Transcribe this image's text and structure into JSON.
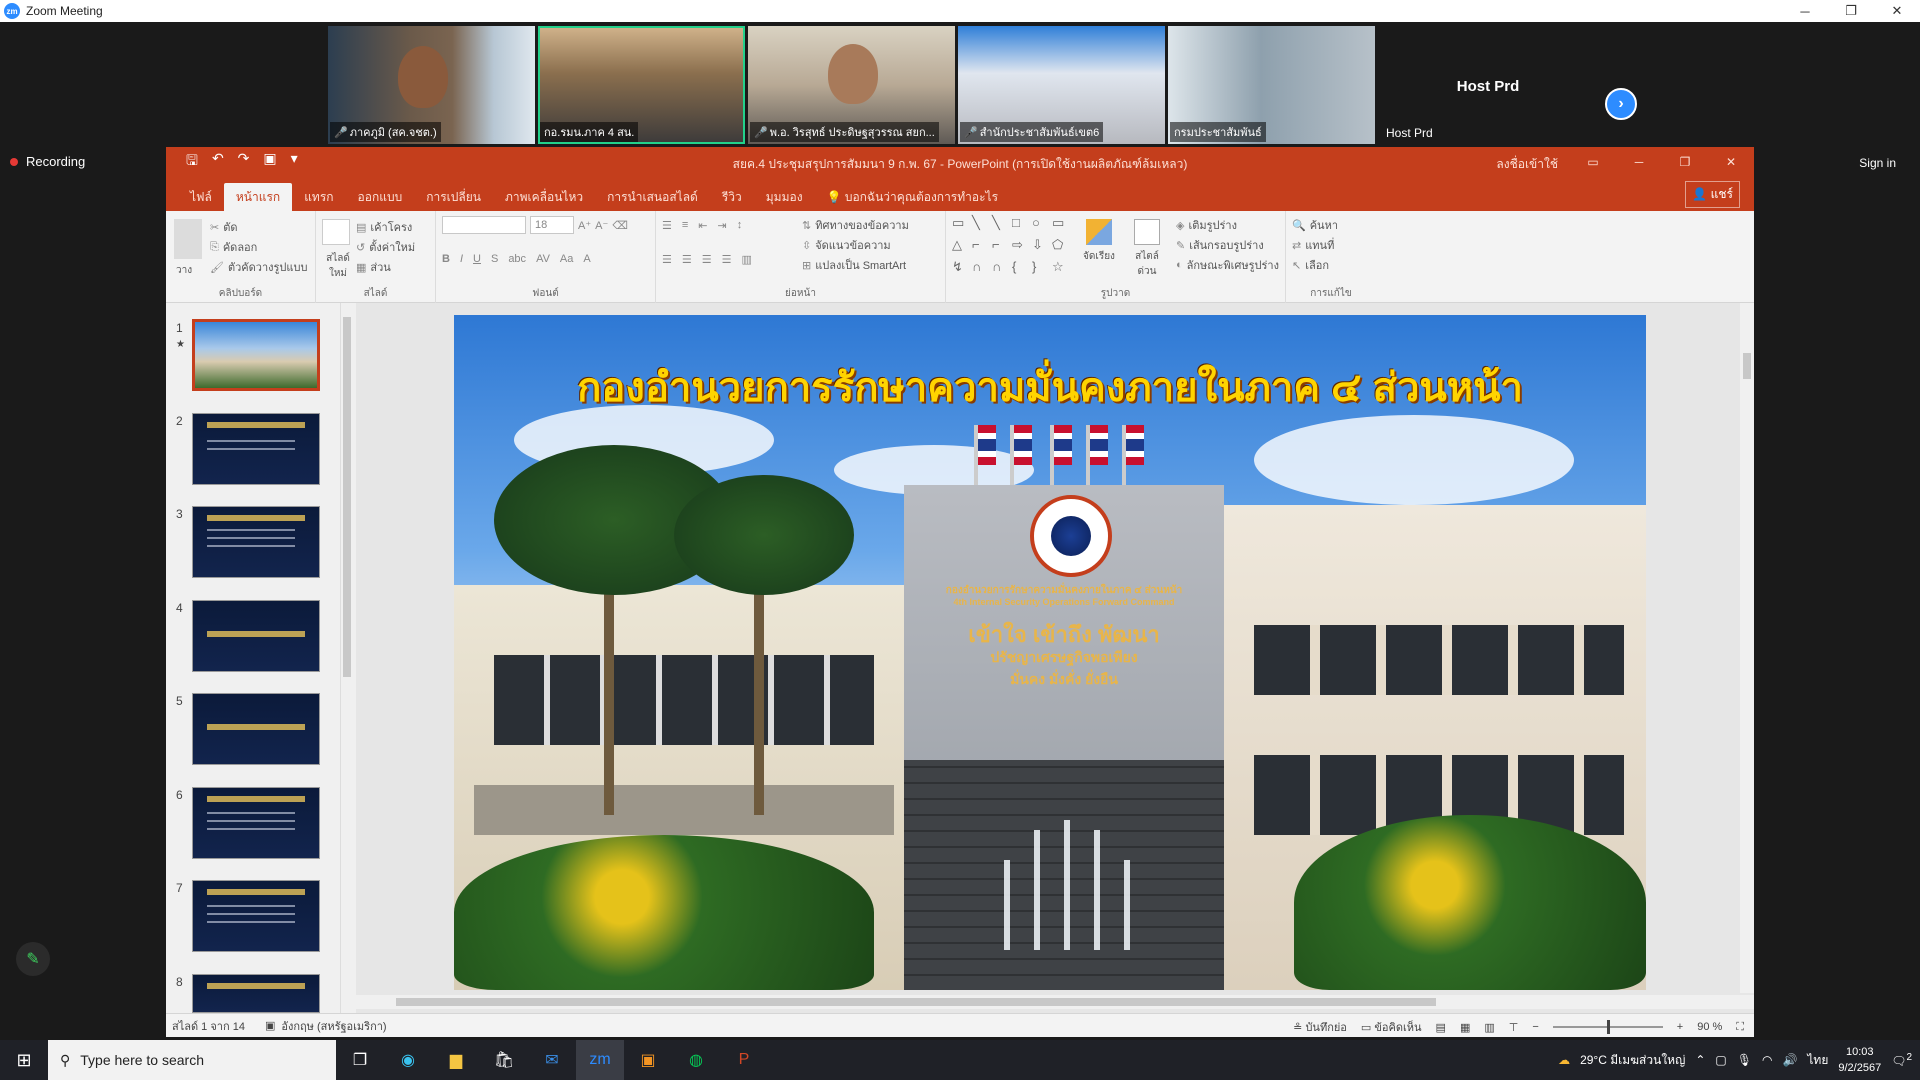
{
  "zoom": {
    "title": "Zoom Meeting",
    "logo_text": "zm",
    "recording_label": "Recording",
    "sign_in": "Sign in",
    "host_name_big": "Host Prd",
    "host_name_small": "Host Prd",
    "participants": [
      {
        "name": "ภาคภูมิ (สค.จชต.)",
        "muted": true
      },
      {
        "name": "กอ.รมน.ภาค 4 สน.",
        "muted": false
      },
      {
        "name": "พ.อ. วิรสุทธ์ ประดิษฐสุวรรณ สยก...",
        "muted": true
      },
      {
        "name": "สำนักประชาสัมพันธ์เขต6",
        "muted": true
      },
      {
        "name": "กรมประชาสัมพันธ์",
        "muted": false
      }
    ]
  },
  "powerpoint": {
    "doc_title": "สยค.4 ประชุมสรุปการสัมมนา 9 ก.พ. 67 - PowerPoint (การเปิดใช้งานผลิตภัณฑ์ล้มเหลว)",
    "sign_in": "ลงชื่อเข้าใช้",
    "share": "แชร์",
    "tabs": [
      "ไฟล์",
      "หน้าแรก",
      "แทรก",
      "ออกแบบ",
      "การเปลี่ยน",
      "ภาพเคลื่อนไหว",
      "การนำเสนอสไลด์",
      "รีวิว",
      "มุมมอง",
      "บอกฉันว่าคุณต้องการทำอะไร"
    ],
    "active_tab": "หน้าแรก",
    "ribbon": {
      "clipboard": {
        "paste": "วาง",
        "cut": "ตัด",
        "copy": "คัดลอก",
        "format_painter": "ตัวคัดวางรูปแบบ",
        "label": "คลิปบอร์ด"
      },
      "slides": {
        "new_slide": "สไลด์ใหม่",
        "layout": "เค้าโครง",
        "reset": "ตั้งค่าใหม่",
        "section": "ส่วน",
        "label": "สไลด์"
      },
      "font": {
        "size": "18",
        "label": "ฟอนต์"
      },
      "paragraph": {
        "text_direction": "ทิศทางของข้อความ",
        "align_text": "จัดแนวข้อความ",
        "smartart": "แปลงเป็น SmartArt",
        "label": "ย่อหน้า"
      },
      "drawing": {
        "arrange": "จัดเรียง",
        "quick_styles": "สไตล์ด่วน",
        "shape_fill": "เติมรูปร่าง",
        "shape_outline": "เส้นกรอบรูปร่าง",
        "shape_effects": "ลักษณะพิเศษรูปร่าง",
        "label": "รูปวาด"
      },
      "editing": {
        "find": "ค้นหา",
        "replace": "แทนที่",
        "select": "เลือก",
        "label": "การแก้ไข"
      }
    },
    "slide": {
      "title": "กองอำนวยการรักษาความมั่นคงภายในภาค ๔ ส่วนหน้า",
      "sign_line1": "กองอำนวยการรักษาความมั่นคงภายในภาค ๔ ส่วนหน้า",
      "sign_line2": "4th Internal Security Operations Forward Command",
      "sign_line3": "เข้าใจ เข้าถึง พัฒนา",
      "sign_line4": "ปรัชญาเศรษฐกิจพอเพียง",
      "sign_line5": "มั่นคง มั่งคั่ง ยั่งยืน"
    },
    "thumbnails": [
      "1",
      "2",
      "3",
      "4",
      "5",
      "6",
      "7",
      "8"
    ],
    "status": {
      "slide_count": "สไลด์ 1 จาก 14",
      "language": "อังกฤษ (สหรัฐอเมริกา)",
      "notes": "บันทึกย่อ",
      "comments": "ข้อคิดเห็น",
      "zoom": "90 %"
    }
  },
  "taskbar": {
    "search_placeholder": "Type here to search",
    "weather": "29°C มีเมฆส่วนใหญ่",
    "lang": "ไทย",
    "time": "10:03",
    "date": "9/2/2567",
    "notif_count": "2"
  }
}
